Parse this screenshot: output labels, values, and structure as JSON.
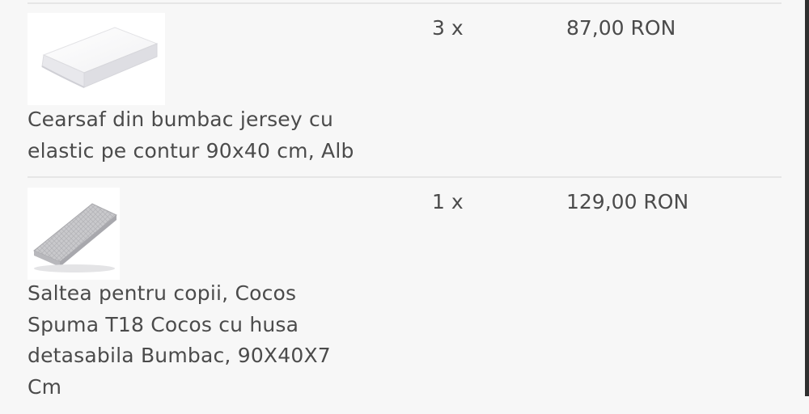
{
  "cart": {
    "items": [
      {
        "image_alt": "Cearsaf din bumbac jersey alb",
        "name_lines": [
          "Cearsaf din bumbac jersey cu",
          "elastic pe contur 90x40 cm, Alb"
        ],
        "quantity": "3 x",
        "price": "87,00 RON"
      },
      {
        "image_alt": "Saltea pentru copii Cocos",
        "name_lines": [
          "Saltea pentru copii, Cocos",
          "Spuma T18 Cocos cu husa",
          "detasabila Bumbac, 90X40X7",
          "Cm"
        ],
        "quantity": "1 x",
        "price": "129,00 RON"
      }
    ]
  },
  "colors": {
    "background": "#f7f7f7",
    "text": "#4b4b4b",
    "divider": "#e6e6e6"
  }
}
